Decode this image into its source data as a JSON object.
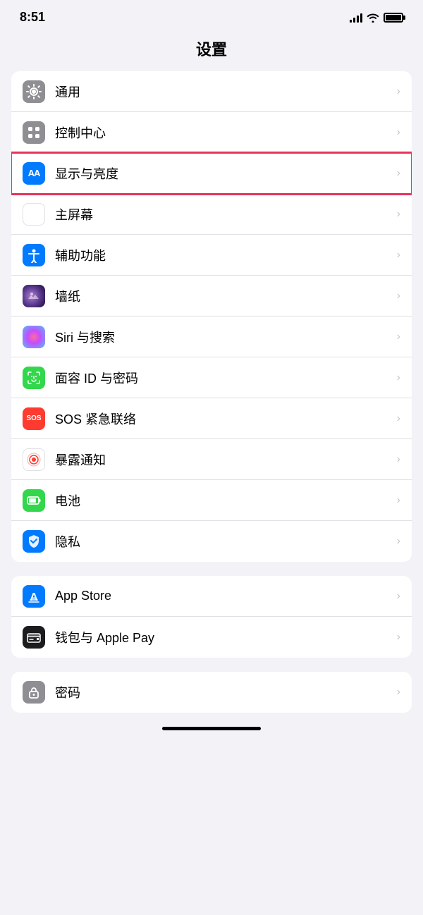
{
  "statusBar": {
    "time": "8:51",
    "signal": "signal",
    "wifi": "wifi",
    "battery": "battery"
  },
  "pageTitle": "设置",
  "groups": [
    {
      "id": "group1",
      "items": [
        {
          "id": "general",
          "label": "通用",
          "iconType": "gear",
          "iconBg": "gray",
          "highlighted": false
        },
        {
          "id": "control-center",
          "label": "控制中心",
          "iconType": "control",
          "iconBg": "gray",
          "highlighted": false
        },
        {
          "id": "display",
          "label": "显示与亮度",
          "iconType": "aa",
          "iconBg": "blue",
          "highlighted": true
        },
        {
          "id": "homescreen",
          "label": "主屏幕",
          "iconType": "homescreen",
          "iconBg": "multi",
          "highlighted": false
        },
        {
          "id": "accessibility",
          "label": "辅助功能",
          "iconType": "accessibility",
          "iconBg": "blue",
          "highlighted": false
        },
        {
          "id": "wallpaper",
          "label": "墙纸",
          "iconType": "wallpaper",
          "iconBg": "wallpaper",
          "highlighted": false
        },
        {
          "id": "siri",
          "label": "Siri 与搜索",
          "iconType": "siri",
          "iconBg": "siri",
          "highlighted": false
        },
        {
          "id": "faceid",
          "label": "面容 ID 与密码",
          "iconType": "faceid",
          "iconBg": "green",
          "highlighted": false
        },
        {
          "id": "sos",
          "label": "SOS 紧急联络",
          "iconType": "sos",
          "iconBg": "red",
          "highlighted": false
        },
        {
          "id": "exposure",
          "label": "暴露通知",
          "iconType": "exposure",
          "iconBg": "exposure",
          "highlighted": false
        },
        {
          "id": "battery",
          "label": "电池",
          "iconType": "battery",
          "iconBg": "green",
          "highlighted": false
        },
        {
          "id": "privacy",
          "label": "隐私",
          "iconType": "privacy",
          "iconBg": "blue",
          "highlighted": false
        }
      ]
    },
    {
      "id": "group2",
      "items": [
        {
          "id": "appstore",
          "label": "App Store",
          "iconType": "appstore",
          "iconBg": "blue",
          "highlighted": false
        },
        {
          "id": "wallet",
          "label": "钱包与 Apple Pay",
          "iconType": "wallet",
          "iconBg": "black",
          "highlighted": false
        }
      ]
    },
    {
      "id": "group3",
      "items": [
        {
          "id": "password",
          "label": "密码",
          "iconType": "password",
          "iconBg": "gray",
          "highlighted": false
        }
      ]
    }
  ]
}
